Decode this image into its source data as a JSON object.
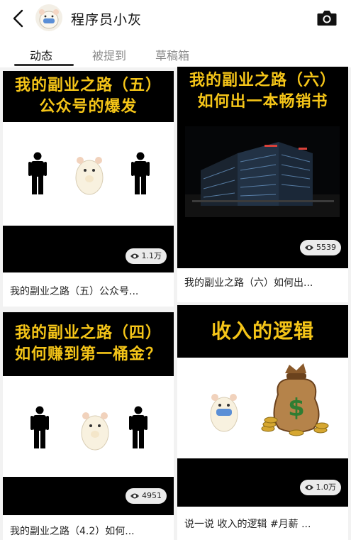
{
  "header": {
    "title": "程序员小灰",
    "back_icon": "chevron-left-icon",
    "camera_icon": "camera-icon"
  },
  "tabs": [
    {
      "label": "动态",
      "active": true
    },
    {
      "label": "被提到",
      "active": false
    },
    {
      "label": "草稿箱",
      "active": false
    }
  ],
  "cards": [
    {
      "banner": [
        "我的副业之路（五）",
        "公众号的爆发"
      ],
      "views": "1.1万",
      "caption": "我的副业之路（五）公众号..."
    },
    {
      "banner": [
        "我的副业之路（六）",
        "如何出一本畅销书"
      ],
      "views": "5539",
      "caption": "我的副业之路（六）如何出..."
    },
    {
      "banner": [
        "我的副业之路（四）",
        "如何赚到第一桶金？"
      ],
      "views": "4951",
      "caption": "我的副业之路（4.2）如何..."
    },
    {
      "banner": [
        "收入的逻辑"
      ],
      "views": "1.0万",
      "caption": "说一说 收入的逻辑 #月薪 ..."
    }
  ],
  "colors": {
    "banner_text": "#f5c518",
    "banner_bg": "#000000",
    "page_bg": "#f2f2f2"
  }
}
